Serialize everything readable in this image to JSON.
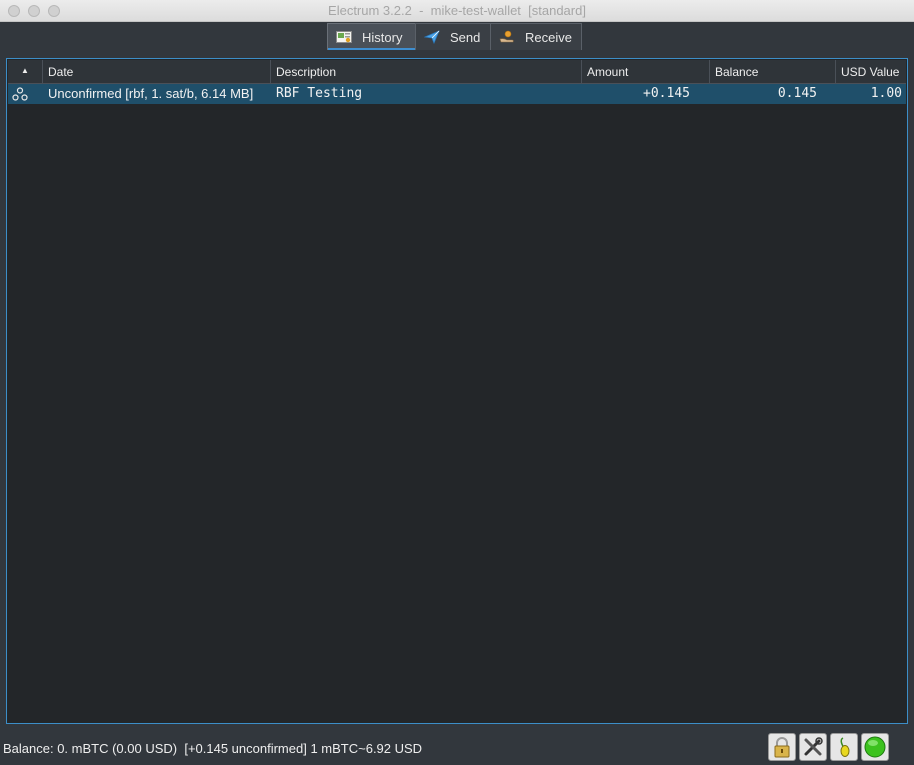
{
  "window": {
    "title": "Electrum 3.2.2  -  mike-test-wallet  [standard]"
  },
  "tabs": [
    {
      "label": "History",
      "icon": "history-icon",
      "active": true
    },
    {
      "label": "Send",
      "icon": "send-icon",
      "active": false
    },
    {
      "label": "Receive",
      "icon": "receive-icon",
      "active": false
    }
  ],
  "table": {
    "columns": [
      "",
      "Date",
      "Description",
      "Amount",
      "Balance",
      "USD Value"
    ],
    "sort_indicator": "▲",
    "rows": [
      {
        "status_icon": "unconfirmed-icon",
        "date": "Unconfirmed [rbf, 1. sat/b, 6.14 MB]",
        "description": "RBF Testing",
        "amount": "+0.145",
        "balance": "0.145",
        "usd_value": "1.00"
      }
    ]
  },
  "statusbar": {
    "text": "Balance: 0. mBTC (0.00 USD)  [+0.145 unconfirmed] 1 mBTC~6.92 USD",
    "buttons": [
      "lock-icon",
      "tools-icon",
      "seed-icon",
      "network-status-icon"
    ]
  },
  "colors": {
    "background": "#32373d",
    "table_bg": "#232629",
    "selected_row": "#1f4f6a",
    "accent": "#3c8ec8",
    "network_ok": "#3cc21e"
  }
}
